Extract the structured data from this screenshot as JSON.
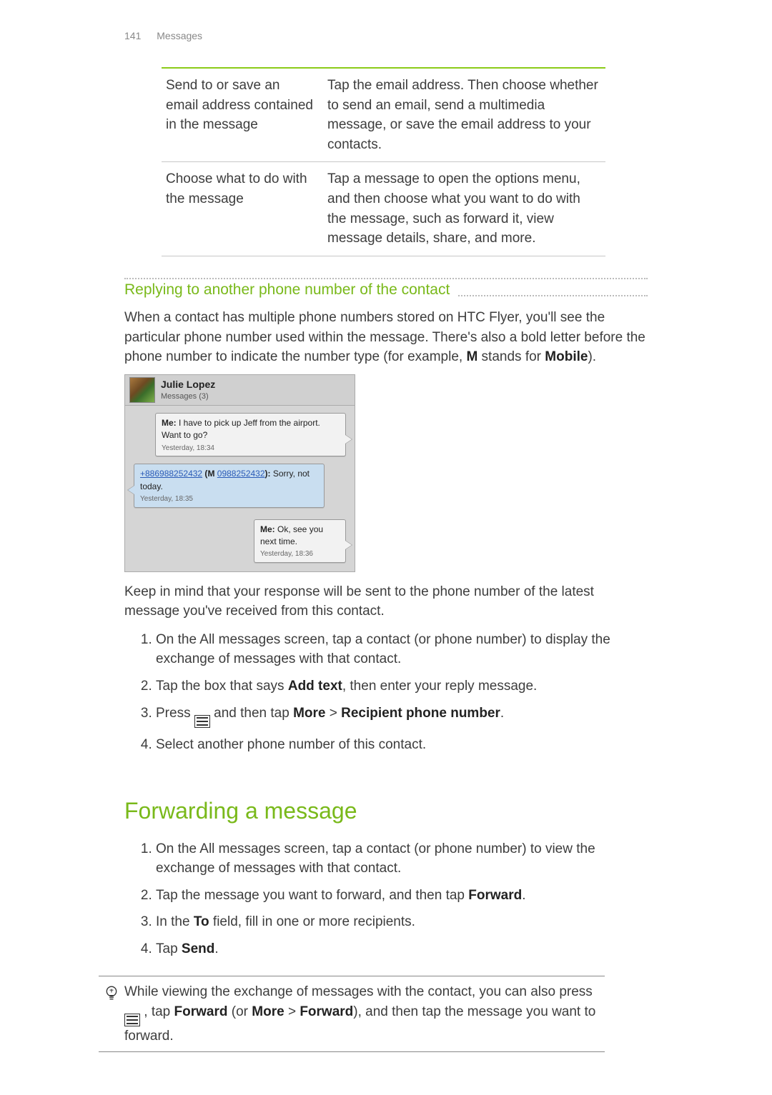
{
  "header": {
    "page_number": "141",
    "section": "Messages"
  },
  "info_table": {
    "rows": [
      {
        "left": "Send to or save an email address contained in the message",
        "right": "Tap the email address. Then choose whether to send an email, send a multimedia message, or save the email address to your contacts."
      },
      {
        "left": "Choose what to do with the message",
        "right": "Tap a message to open the options menu, and then choose what you want to do with the message, such as forward it, view message details, share, and more."
      }
    ]
  },
  "reply_section": {
    "title": "Replying to another phone number of the contact",
    "intro_pre": "When a contact has multiple phone numbers stored on HTC Flyer, you'll see the particular phone number used within the message. There's also a bold letter before the phone number to indicate the number type (for example, ",
    "intro_bold1": "M",
    "intro_mid": " stands for ",
    "intro_bold2": "Mobile",
    "intro_post": ").",
    "conversation": {
      "contact_name": "Julie Lopez",
      "contact_sub": "Messages (3)",
      "msg1_prefix": "Me:",
      "msg1_body": " I have to pick up Jeff from the airport. Want to go?",
      "msg1_time": "Yesterday, 18:34",
      "msg2_phone1": "+886988252432",
      "msg2_tag_open": " (",
      "msg2_tag": "M",
      "msg2_space": " ",
      "msg2_phone2": "0988252432",
      "msg2_tag_close": "):",
      "msg2_body": " Sorry, not today.",
      "msg2_time": "Yesterday, 18:35",
      "msg3_prefix": "Me:",
      "msg3_body": " Ok, see you next time.",
      "msg3_time": "Yesterday, 18:36"
    },
    "note": "Keep in mind that your response will be sent to the phone number of the latest message you've received from this contact.",
    "steps": {
      "s1": "On the All messages screen, tap a contact (or phone number) to display the exchange of messages with that contact.",
      "s2_pre": "Tap the box that says ",
      "s2_bold": "Add text",
      "s2_post": ", then enter your reply message.",
      "s3_pre": "Press ",
      "s3_mid": " and then tap ",
      "s3_bold1": "More",
      "s3_sep": " > ",
      "s3_bold2": "Recipient phone number",
      "s3_post": ".",
      "s4": "Select another phone number of this contact."
    }
  },
  "forward_section": {
    "title": "Forwarding a message",
    "steps": {
      "s1": "On the All messages screen, tap a contact (or phone number) to view the exchange of messages with that contact.",
      "s2_pre": "Tap the message you want to forward, and then tap ",
      "s2_bold": "Forward",
      "s2_post": ".",
      "s3_pre": "In the ",
      "s3_bold": "To",
      "s3_post": " field, fill in one or more recipients.",
      "s4_pre": "Tap ",
      "s4_bold": "Send",
      "s4_post": "."
    },
    "tip": {
      "pre": "While viewing the exchange of messages with the contact, you can also press ",
      "mid1": " , tap ",
      "b1": "Forward",
      "mid2": " (or ",
      "b2": "More",
      "mid3": " > ",
      "b3": "Forward",
      "post": "), and then tap the message you want to forward."
    }
  }
}
